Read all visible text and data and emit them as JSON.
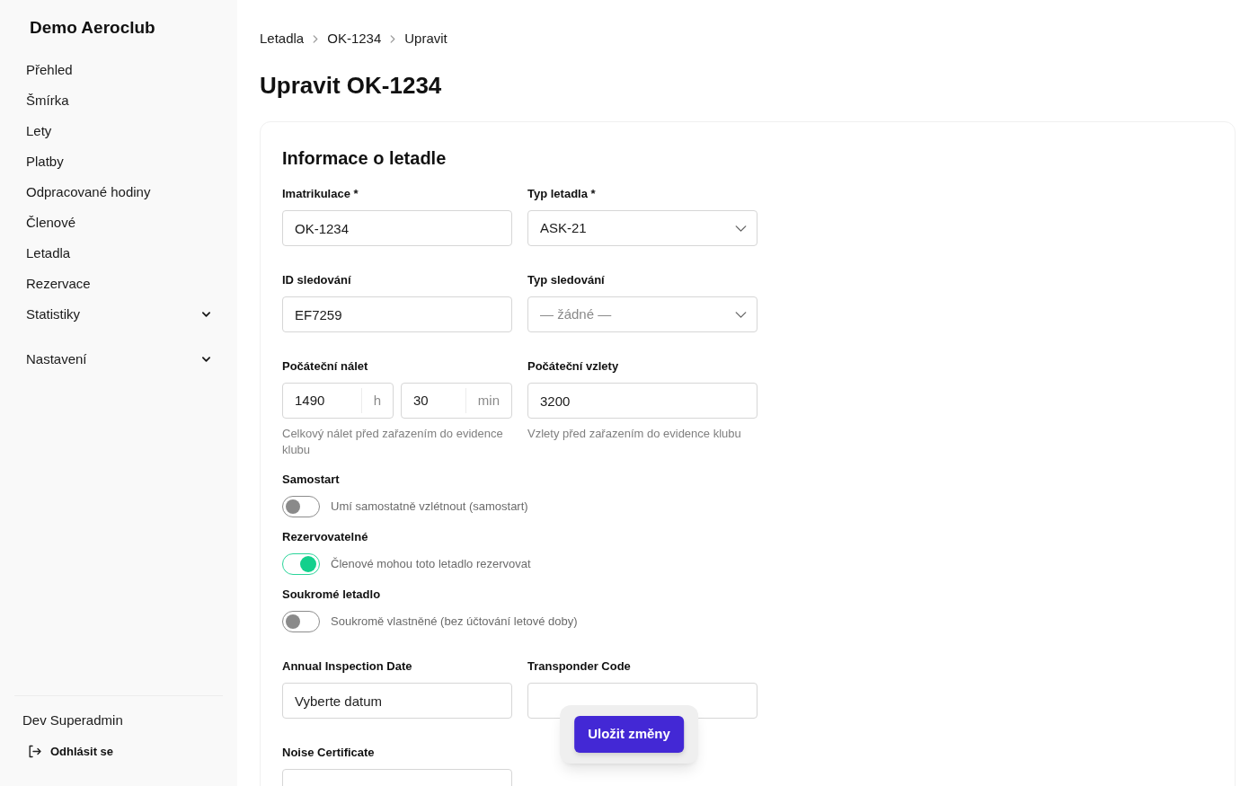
{
  "sidebar": {
    "brand": "Demo Aeroclub",
    "nav_items": [
      {
        "kind": "link",
        "label": "Přehled"
      },
      {
        "kind": "link",
        "label": "Šmírka"
      },
      {
        "kind": "link",
        "label": "Lety"
      },
      {
        "kind": "link",
        "label": "Platby"
      },
      {
        "kind": "link",
        "label": "Odpracované hodiny"
      },
      {
        "kind": "link",
        "label": "Členové"
      },
      {
        "kind": "link",
        "label": "Letadla"
      },
      {
        "kind": "link",
        "label": "Rezervace"
      },
      {
        "kind": "group",
        "label": "Statistiky",
        "expanded": false
      },
      {
        "kind": "group",
        "label": "Nastavení",
        "expanded": false
      }
    ],
    "user_name": "Dev Superadmin",
    "logout_label": "Odhlásit se"
  },
  "breadcrumb": [
    {
      "label": "Letadla"
    },
    {
      "label": "OK-1234"
    },
    {
      "label": "Upravit"
    }
  ],
  "page_title": "Upravit OK-1234",
  "form": {
    "title": "Informace o letadle",
    "rows": [
      {
        "kind": "fields",
        "fields": [
          {
            "kind": "text",
            "label": "Imatrikulace *",
            "value": "OK-1234"
          },
          {
            "kind": "select",
            "label": "Typ letadla *",
            "value": "ASK-21"
          }
        ]
      },
      {
        "kind": "fields",
        "fields": [
          {
            "kind": "text",
            "label": "ID sledování",
            "value": "EF7259"
          },
          {
            "kind": "select",
            "label": "Typ sledování",
            "placeholder": "— žádné —"
          }
        ]
      },
      {
        "kind": "fields",
        "fields": [
          {
            "kind": "duration",
            "label": "Počáteční nálet",
            "hours": "1490",
            "hours_unit": "h",
            "minutes": "30",
            "minutes_unit": "min",
            "help": "Celkový nálet před zařazením do evidence klubu"
          },
          {
            "kind": "text",
            "label": "Počáteční vzlety",
            "value": "3200",
            "help": "Vzlety před zařazením do evidence klubu"
          }
        ]
      },
      {
        "kind": "toggle",
        "label": "Samostart",
        "text": "Umí samostatně vzlétnout (samostart)",
        "on": false
      },
      {
        "kind": "toggle",
        "label": "Rezervovatelné",
        "text": "Členové mohou toto letadlo rezervovat",
        "on": true
      },
      {
        "kind": "toggle",
        "label": "Soukromé letadlo",
        "text": "Soukromě vlastněné (bez účtování letové doby)",
        "on": false
      },
      {
        "kind": "fields",
        "fields": [
          {
            "kind": "date",
            "label": "Annual Inspection Date",
            "placeholder": "Vyberte datum"
          },
          {
            "kind": "text",
            "label": "Transponder Code"
          }
        ]
      },
      {
        "kind": "fields",
        "fields": [
          {
            "kind": "text",
            "label": "Noise Certificate"
          }
        ]
      }
    ]
  },
  "save_button": "Uložit změny"
}
